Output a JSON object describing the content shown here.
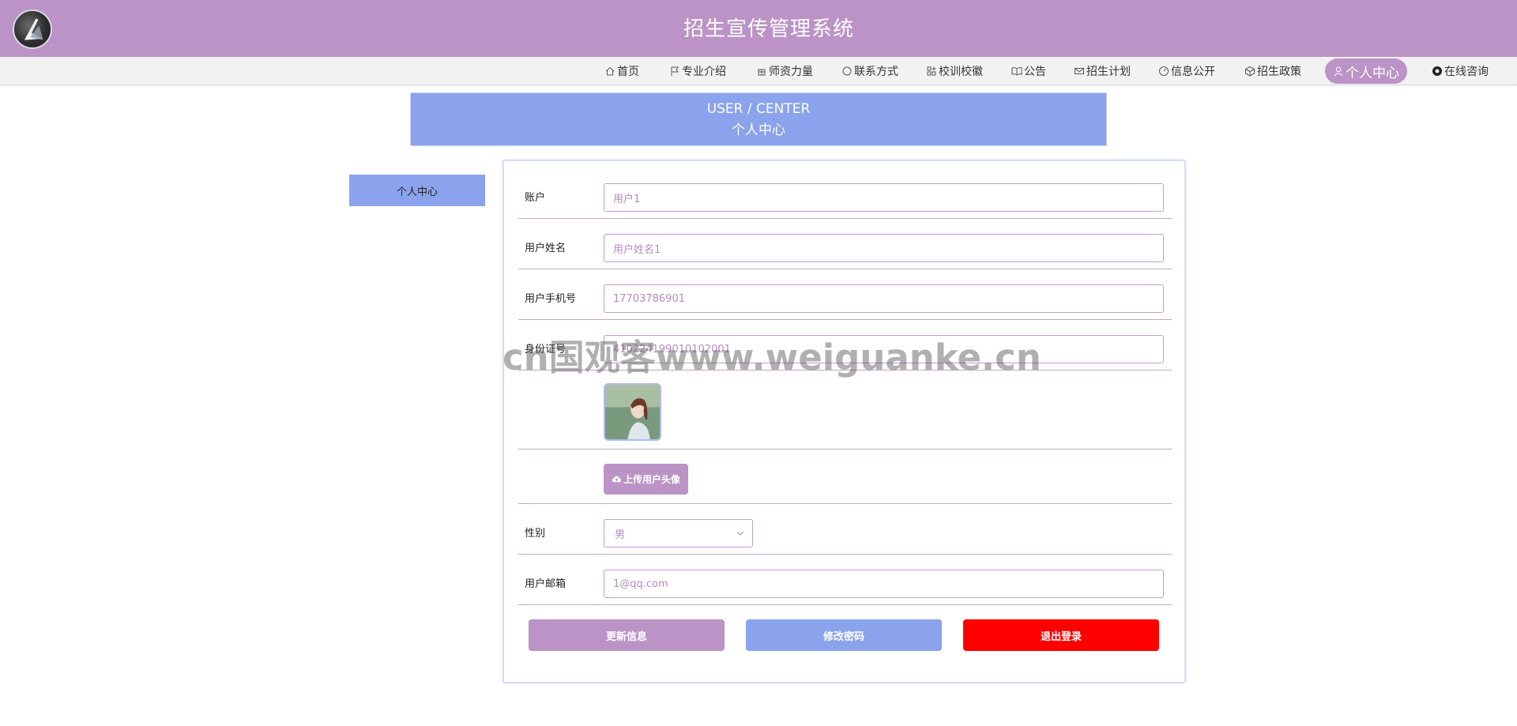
{
  "header": {
    "title": "招生宣传管理系统",
    "logo_icon": "logo-icon"
  },
  "nav": {
    "items": [
      {
        "label": "首页",
        "icon": "home-icon"
      },
      {
        "label": "专业介绍",
        "icon": "flag-icon"
      },
      {
        "label": "师资力量",
        "icon": "gift-icon"
      },
      {
        "label": "联系方式",
        "icon": "chat-bubble-icon"
      },
      {
        "label": "校训校徽",
        "icon": "grid-add-icon"
      },
      {
        "label": "公告",
        "icon": "open-book-icon"
      },
      {
        "label": "招生计划",
        "icon": "mail-icon"
      },
      {
        "label": "信息公开",
        "icon": "gauge-icon"
      },
      {
        "label": "招生政策",
        "icon": "cube-icon"
      },
      {
        "label": "个人中心",
        "icon": "user-icon",
        "active": true
      },
      {
        "label": "在线咨询",
        "icon": "chat-filled-icon"
      }
    ]
  },
  "banner": {
    "en": "USER / CENTER",
    "cn": "个人中心"
  },
  "sidebar": {
    "items": [
      {
        "label": "个人中心"
      }
    ]
  },
  "form": {
    "account": {
      "label": "账户",
      "value": "用户1"
    },
    "name": {
      "label": "用户姓名",
      "value": "用户姓名1"
    },
    "phone": {
      "label": "用户手机号",
      "value": "17703786901"
    },
    "idcard": {
      "label": "身份证号",
      "value": "410224199010102001"
    },
    "upload_label": "上传用户头像",
    "gender": {
      "label": "性别",
      "value": "男"
    },
    "email": {
      "label": "用户邮箱",
      "value": "1@qq.com"
    }
  },
  "actions": {
    "update": "更新信息",
    "change_password": "修改密码",
    "logout": "退出登录"
  },
  "colors": {
    "primary": "#bc93c6",
    "secondary": "#8aa3ec",
    "danger": "#ff0000"
  },
  "watermark": "cn国观客www.weiguanke.cn"
}
